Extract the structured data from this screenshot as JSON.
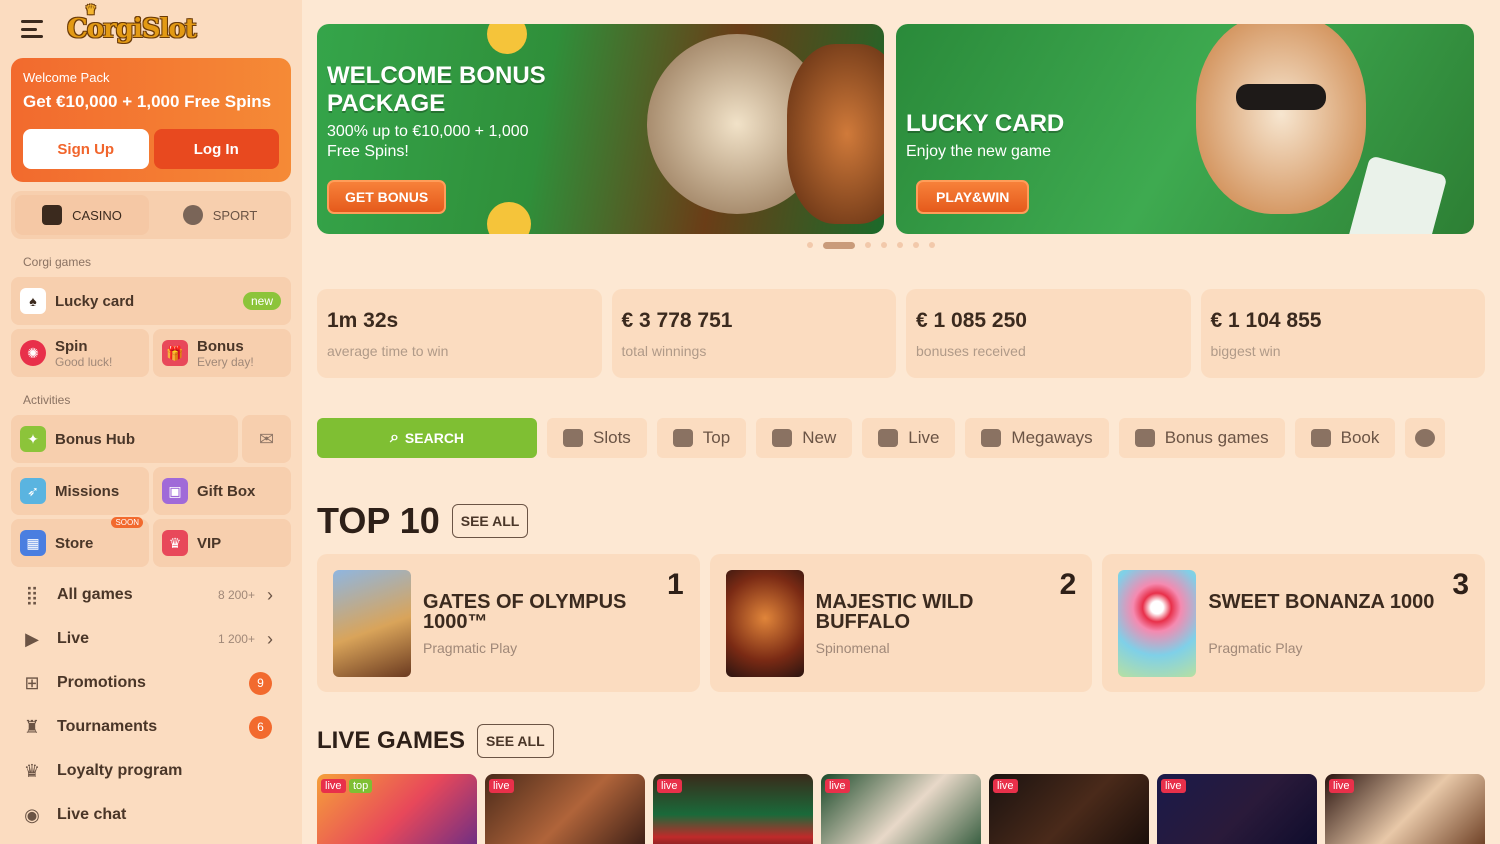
{
  "sidebar": {
    "logo": "CorgiSlot",
    "welcome": {
      "small": "Welcome Pack",
      "big": "Get €10,000 + 1,000 Free Spins",
      "signup": "Sign Up",
      "login": "Log In"
    },
    "modes": {
      "casino": "CASINO",
      "sport": "SPORT"
    },
    "corgi_section": "Corgi games",
    "lucky": {
      "label": "Lucky card",
      "badge": "new"
    },
    "spin": {
      "label": "Spin",
      "sub": "Good luck!"
    },
    "bonus": {
      "label": "Bonus",
      "sub": "Every day!"
    },
    "activities_section": "Activities",
    "bonus_hub": "Bonus Hub",
    "missions": "Missions",
    "gift_box": "Gift Box",
    "store": "Store",
    "soon": "SOON",
    "vip": "VIP",
    "menu": [
      {
        "label": "All games",
        "count": "8 200+"
      },
      {
        "label": "Live",
        "count": "1 200+"
      },
      {
        "label": "Promotions",
        "badge": "9"
      },
      {
        "label": "Tournaments",
        "badge": "6"
      },
      {
        "label": "Loyalty program"
      },
      {
        "label": "Live chat"
      }
    ]
  },
  "banners": [
    {
      "title": "WELCOME BONUS PACKAGE",
      "sub": "300% up to €10,000 + 1,000 Free Spins!",
      "btn": "GET BONUS"
    },
    {
      "title": "LUCKY CARD",
      "sub": "Enjoy the new game",
      "btn": "PLAY&WIN"
    }
  ],
  "stats": [
    {
      "value": "1m 32s",
      "label": "average time to win"
    },
    {
      "value": "€ 3 778 751",
      "label": "total winnings"
    },
    {
      "value": "€ 1 085 250",
      "label": "bonuses received"
    },
    {
      "value": "€ 1 104 855",
      "label": "biggest win"
    }
  ],
  "categories": {
    "search": "SEARCH",
    "items": [
      "Slots",
      "Top",
      "New",
      "Live",
      "Megaways",
      "Bonus games",
      "Book"
    ]
  },
  "top10": {
    "title": "TOP 10",
    "see_all": "SEE ALL",
    "games": [
      {
        "rank": "1",
        "name": "GATES OF OLYMPUS 1000™",
        "provider": "Pragmatic Play"
      },
      {
        "rank": "2",
        "name": "MAJESTIC WILD BUFFALO",
        "provider": "Spinomenal"
      },
      {
        "rank": "3",
        "name": "SWEET BONANZA 1000",
        "provider": "Pragmatic Play"
      }
    ]
  },
  "live": {
    "title": "LIVE GAMES",
    "see_all": "SEE ALL",
    "tag": "live",
    "tag_top": "top"
  },
  "colors": {
    "accent": "#f26a2e",
    "green": "#7fbf33",
    "bg": "#fde8d3",
    "card": "#fbdcc0"
  }
}
